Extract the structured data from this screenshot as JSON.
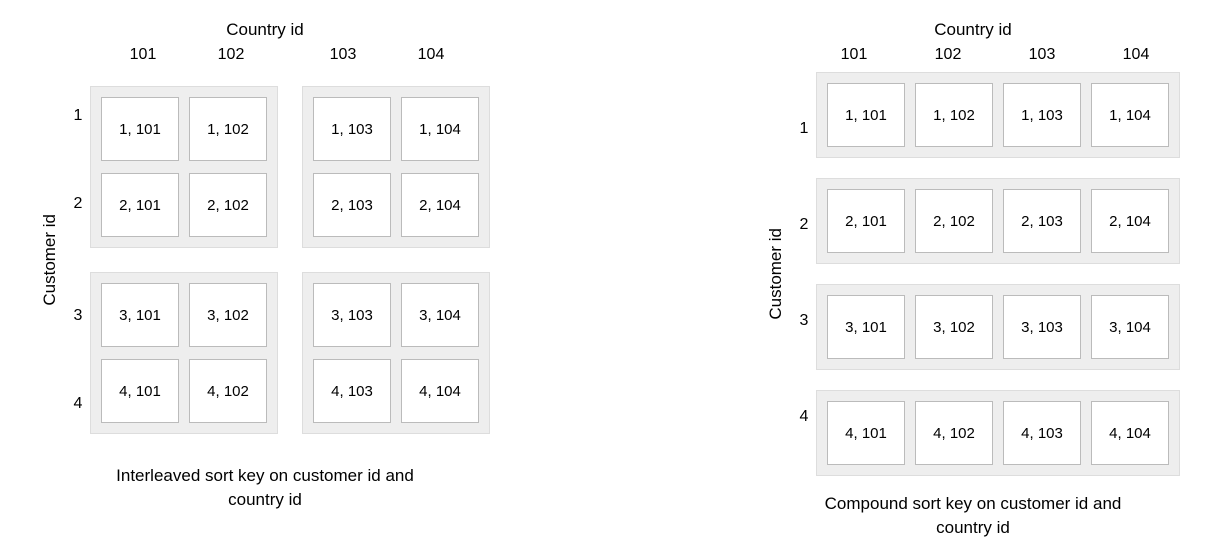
{
  "shared": {
    "top_axis_title": "Country id",
    "side_axis_title": "Customer id",
    "col_headers": [
      "101",
      "102",
      "103",
      "104"
    ],
    "row_headers": [
      "1",
      "2",
      "3",
      "4"
    ]
  },
  "interleaved": {
    "caption_line1": "Interleaved sort key on customer id and",
    "caption_line2": "country id",
    "blocks": [
      {
        "cells": [
          {
            "r": 1,
            "c": 101,
            "label": "1, 101"
          },
          {
            "r": 1,
            "c": 102,
            "label": "1, 102"
          },
          {
            "r": 2,
            "c": 101,
            "label": "2, 101"
          },
          {
            "r": 2,
            "c": 102,
            "label": "2, 102"
          }
        ]
      },
      {
        "cells": [
          {
            "r": 1,
            "c": 103,
            "label": "1, 103"
          },
          {
            "r": 1,
            "c": 104,
            "label": "1, 104"
          },
          {
            "r": 2,
            "c": 103,
            "label": "2, 103"
          },
          {
            "r": 2,
            "c": 104,
            "label": "2, 104"
          }
        ]
      },
      {
        "cells": [
          {
            "r": 3,
            "c": 101,
            "label": "3, 101"
          },
          {
            "r": 3,
            "c": 102,
            "label": "3, 102"
          },
          {
            "r": 4,
            "c": 101,
            "label": "4, 101"
          },
          {
            "r": 4,
            "c": 102,
            "label": "4, 102"
          }
        ]
      },
      {
        "cells": [
          {
            "r": 3,
            "c": 103,
            "label": "3, 103"
          },
          {
            "r": 3,
            "c": 104,
            "label": "3, 104"
          },
          {
            "r": 4,
            "c": 103,
            "label": "4, 103"
          },
          {
            "r": 4,
            "c": 104,
            "label": "4, 104"
          }
        ]
      }
    ]
  },
  "compound": {
    "caption_line1": "Compound sort key on customer id and",
    "caption_line2": "country id",
    "strips": [
      [
        {
          "r": 1,
          "c": 101,
          "label": "1, 101"
        },
        {
          "r": 1,
          "c": 102,
          "label": "1, 102"
        },
        {
          "r": 1,
          "c": 103,
          "label": "1, 103"
        },
        {
          "r": 1,
          "c": 104,
          "label": "1, 104"
        }
      ],
      [
        {
          "r": 2,
          "c": 101,
          "label": "2, 101"
        },
        {
          "r": 2,
          "c": 102,
          "label": "2, 102"
        },
        {
          "r": 2,
          "c": 103,
          "label": "2, 103"
        },
        {
          "r": 2,
          "c": 104,
          "label": "2, 104"
        }
      ],
      [
        {
          "r": 3,
          "c": 101,
          "label": "3, 101"
        },
        {
          "r": 3,
          "c": 102,
          "label": "3, 102"
        },
        {
          "r": 3,
          "c": 103,
          "label": "3, 103"
        },
        {
          "r": 3,
          "c": 104,
          "label": "3, 104"
        }
      ],
      [
        {
          "r": 4,
          "c": 101,
          "label": "4, 101"
        },
        {
          "r": 4,
          "c": 102,
          "label": "4, 102"
        },
        {
          "r": 4,
          "c": 103,
          "label": "4, 103"
        },
        {
          "r": 4,
          "c": 104,
          "label": "4, 104"
        }
      ]
    ]
  }
}
